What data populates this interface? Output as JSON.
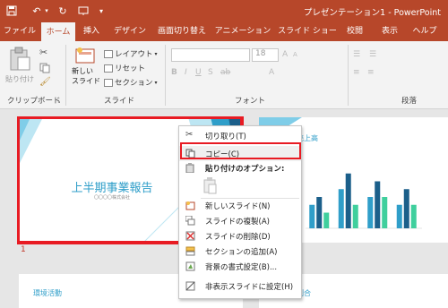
{
  "titlebar": {
    "title": "プレゼンテーション1 - PowerPoint",
    "icons": [
      "save-icon",
      "undo-icon",
      "redo-icon",
      "present-icon",
      "customize-icon"
    ]
  },
  "tabs": [
    "ファイル",
    "ホーム",
    "挿入",
    "デザイン",
    "画面切り替え",
    "アニメーション",
    "スライド ショー",
    "校閲",
    "表示",
    "ヘルプ"
  ],
  "active_tab": "ホーム",
  "ribbon": {
    "clipboard_group": "クリップボード",
    "paste": "貼り付け",
    "slides_group": "スライド",
    "new_slide": "新しい\nスライド",
    "layout": "レイアウト",
    "reset": "リセット",
    "section": "セクション",
    "font_group": "フォント",
    "font_size": "18",
    "paragraph_group": "段落"
  },
  "slides": {
    "slide1_title": "上半期事業報告",
    "slide1_sub": "〇〇〇〇株式会社",
    "slide1_number": "1",
    "slide2_title": "売上高",
    "slide3_title": "環境活動",
    "slide4_title": "割合"
  },
  "context_menu": {
    "cut": "切り取り(T)",
    "copy": "コピー(C)",
    "paste_options": "貼り付けのオプション:",
    "new_slide": "新しいスライド(N)",
    "duplicate": "スライドの複製(A)",
    "delete": "スライドの削除(D)",
    "add_section": "セクションの追加(A)",
    "bg_format": "背景の書式設定(B)...",
    "hide_slide": "非表示スライドに設定(H)"
  },
  "chart_data": {
    "type": "bar",
    "categories": [
      "",
      "",
      "",
      ""
    ],
    "series": [
      {
        "values": [
          3,
          5,
          4,
          3
        ]
      },
      {
        "values": [
          4,
          7,
          6,
          5
        ]
      },
      {
        "values": [
          2,
          3,
          4,
          3
        ]
      }
    ],
    "colors": [
      "#2f9ec9",
      "#1b5f8a",
      "#3fcf9d"
    ]
  },
  "colors": {
    "accent": "#b7472a",
    "highlight": "#e81b23"
  }
}
